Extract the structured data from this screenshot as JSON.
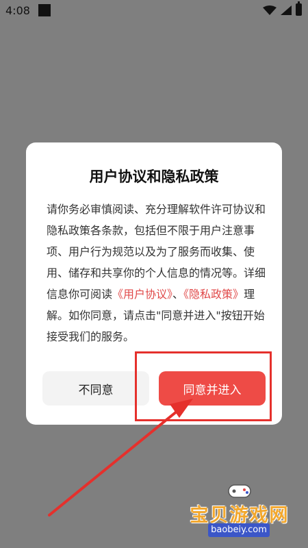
{
  "status_bar": {
    "time": "4:08"
  },
  "dialog": {
    "title": "用户协议和隐私政策",
    "body_intro": "请你务必审慎阅读、充分理解软件许可协议和隐私政策各条款，包括但不限于用户注意事项、用户行为规范以及为了服务而收集、使用、储存和共享你的个人信息的情况等。详细信息你可阅读",
    "link_user_agreement": "《用户协议》",
    "separator": "、",
    "link_privacy_policy": "《隐私政策》",
    "body_outro": "理解。如你同意，请点击\"同意并进入\"按钮开始接受我们的服务。",
    "disagree_label": "不同意",
    "agree_label": "同意并进入"
  },
  "watermark": {
    "title": "宝贝游戏网",
    "url": "baobeiy.com"
  },
  "colors": {
    "overlay": "#7f7f7f",
    "accent": "#ee4b46",
    "link": "#e04848",
    "annotation": "#e5302c"
  }
}
